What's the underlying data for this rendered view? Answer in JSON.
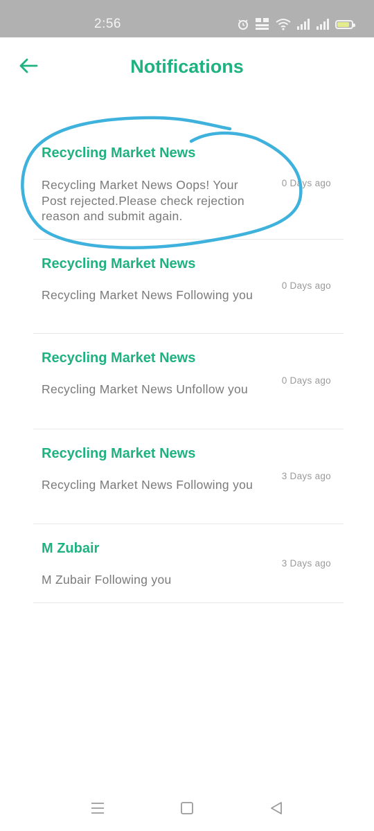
{
  "status_bar": {
    "time": "2:56",
    "battery_level": 0.78,
    "battery_color": "#e3ec8c"
  },
  "header": {
    "title": "Notifications",
    "back_icon": "arrow-left-icon",
    "accent_color": "#1fb281"
  },
  "notifications": [
    {
      "title": "Recycling Market News",
      "message": "Recycling Market News Oops! Your Post rejected.Please check rejection reason and submit again.",
      "time": "0 Days ago",
      "highlighted": true
    },
    {
      "title": "Recycling Market News",
      "message": "Recycling Market News Following you",
      "time": "0 Days ago"
    },
    {
      "title": "Recycling Market News",
      "message": "Recycling Market News Unfollow you",
      "time": "0 Days ago"
    },
    {
      "title": "Recycling Market News",
      "message": "Recycling Market News Following you",
      "time": "3 Days ago"
    },
    {
      "title": "M Zubair",
      "message": "M Zubair Following you",
      "time": "3 Days ago"
    }
  ],
  "annotation": {
    "shape": "hand-drawn-circle",
    "color": "#3eb2dc"
  },
  "nav_bar": {
    "icons": [
      "menu-icon",
      "home-square-icon",
      "back-triangle-icon"
    ]
  }
}
